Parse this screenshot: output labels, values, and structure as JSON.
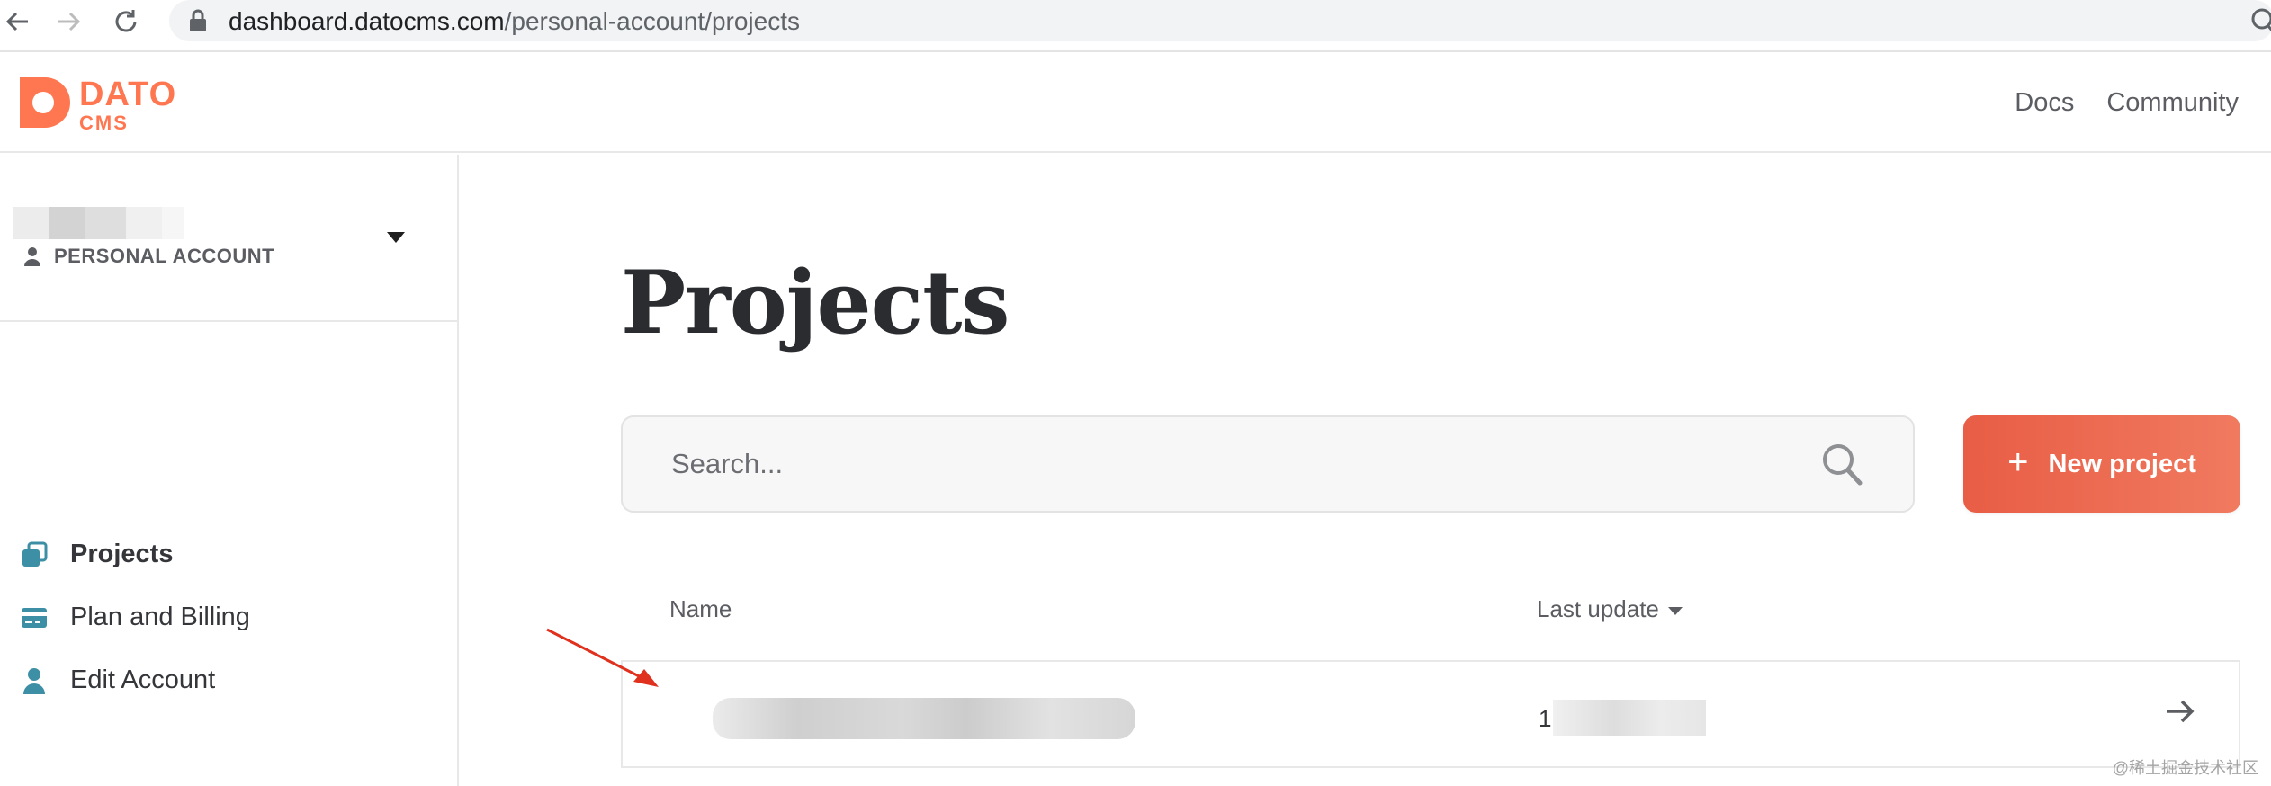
{
  "browser": {
    "url_host": "dashboard.datocms.com",
    "url_path": "/personal-account/projects"
  },
  "header": {
    "logo_line1": "DATO",
    "logo_line2": "CMS",
    "links": [
      "Docs",
      "Community"
    ]
  },
  "sidebar": {
    "account_type": "PERSONAL ACCOUNT",
    "items": [
      {
        "label": "Projects",
        "icon": "projects-icon",
        "active": true
      },
      {
        "label": "Plan and Billing",
        "icon": "card-icon",
        "active": false
      },
      {
        "label": "Edit Account",
        "icon": "user-icon",
        "active": false
      }
    ]
  },
  "main": {
    "title": "Projects",
    "search_placeholder": "Search...",
    "new_project_label": "New project",
    "columns": {
      "name": "Name",
      "last_update": "Last update"
    },
    "rows": [
      {
        "date_prefix": "1"
      }
    ]
  },
  "watermark": "@稀土掘金技术社区",
  "colors": {
    "brand": "#ff7751",
    "button": "#ec6a52",
    "icon_teal": "#3d8fa6"
  }
}
